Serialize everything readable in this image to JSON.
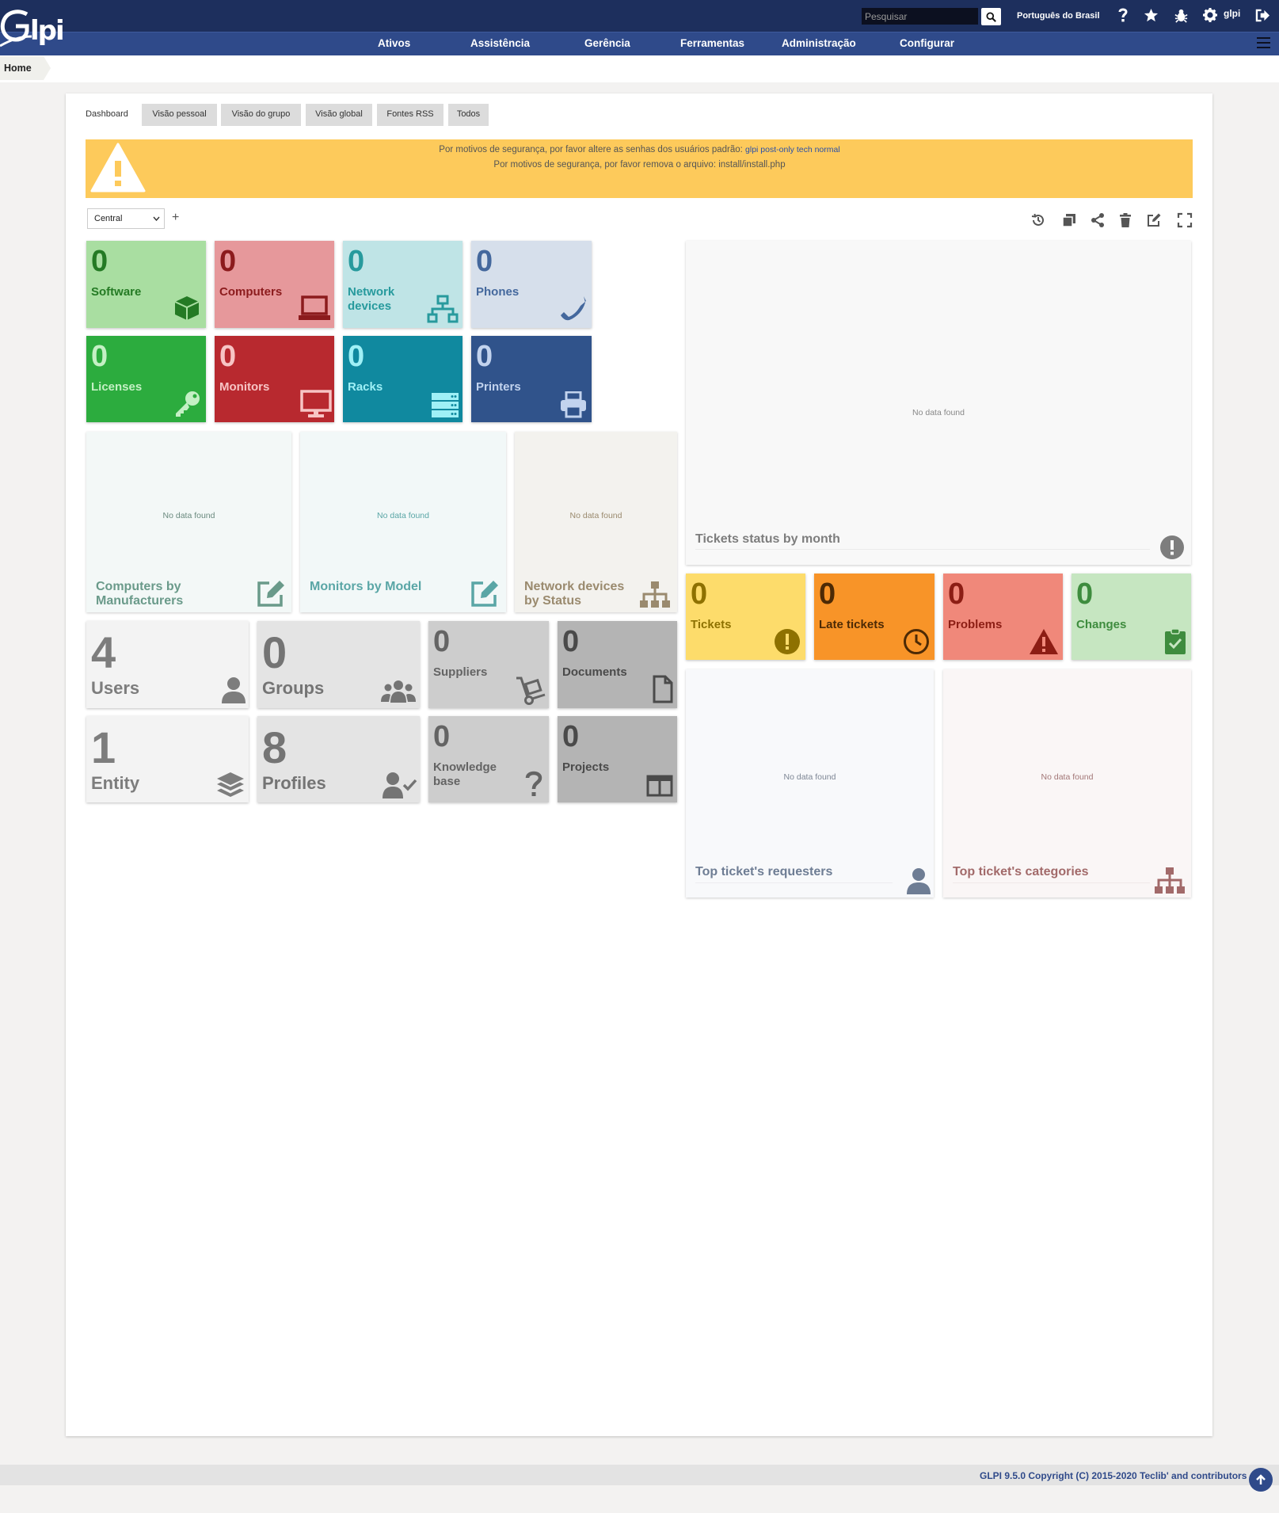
{
  "header": {
    "logo": "Glpi",
    "search_placeholder": "Pesquisar",
    "language": "Português do Brasil",
    "user": "glpi",
    "icons": [
      "help-icon",
      "star-icon",
      "bug-icon",
      "gear-icon",
      "logout-icon"
    ]
  },
  "menu": [
    "Ativos",
    "Assistência",
    "Gerência",
    "Ferramentas",
    "Administração",
    "Configurar"
  ],
  "breadcrumb": {
    "home": "Home"
  },
  "tabs": [
    "Dashboard",
    "Visão pessoal",
    "Visão do grupo",
    "Visão global",
    "Fontes RSS",
    "Todos"
  ],
  "alert": {
    "line1_prefix": "Por motivos de segurança, por favor altere as senhas dos usuários padrão:",
    "line1_links": "glpi post-only tech normal",
    "line2": "Por motivos de segurança, por favor remova o arquivo: install/install.php",
    "color": "#fdca5b"
  },
  "dashboard": {
    "selected": "Central",
    "add_label": "+",
    "tools": [
      "history-icon",
      "clone-icon",
      "share-icon",
      "delete-icon",
      "edit-icon",
      "fullscreen-icon"
    ]
  },
  "cards": {
    "software": {
      "value": "0",
      "label": "Software",
      "icon": "cube-icon",
      "bg": "#a9dea1",
      "fg": "#247a24"
    },
    "computers": {
      "value": "0",
      "label": "Computers",
      "icon": "laptop-icon",
      "bg": "#e6989b",
      "fg": "#8c1b1d"
    },
    "network_devices": {
      "value": "0",
      "label": "Network devices",
      "icon": "network-icon",
      "bg": "#bfe4e6",
      "fg": "#279a9d"
    },
    "phones": {
      "value": "0",
      "label": "Phones",
      "icon": "phone-icon",
      "bg": "#d6dfeb",
      "fg": "#44689d"
    },
    "licenses": {
      "value": "0",
      "label": "Licenses",
      "icon": "key-icon",
      "bg": "#2cac3e",
      "fg": "#c4f0c4"
    },
    "monitors": {
      "value": "0",
      "label": "Monitors",
      "icon": "monitor-icon",
      "bg": "#b8292f",
      "fg": "#f7c4c4"
    },
    "racks": {
      "value": "0",
      "label": "Racks",
      "icon": "server-icon",
      "bg": "#10899f",
      "fg": "#9ff0f6"
    },
    "printers": {
      "value": "0",
      "label": "Printers",
      "icon": "printer-icon",
      "bg": "#30538b",
      "fg": "#c2d3ee"
    },
    "users": {
      "value": "4",
      "label": "Users",
      "icon": "user-icon"
    },
    "groups": {
      "value": "0",
      "label": "Groups",
      "icon": "users-icon"
    },
    "suppliers": {
      "value": "0",
      "label": "Suppliers",
      "icon": "dolly-icon"
    },
    "documents": {
      "value": "0",
      "label": "Documents",
      "icon": "file-icon"
    },
    "entity": {
      "value": "1",
      "label": "Entity",
      "icon": "layers-icon"
    },
    "profiles": {
      "value": "8",
      "label": "Profiles",
      "icon": "user-check-icon"
    },
    "knowledge": {
      "value": "0",
      "label": "Knowledge base",
      "icon": "question-icon"
    },
    "projects": {
      "value": "0",
      "label": "Projects",
      "icon": "columns-icon"
    },
    "tickets": {
      "value": "0",
      "label": "Tickets",
      "icon": "exclamation-circle-icon",
      "bg": "#fddc6b",
      "fg": "#8e7100"
    },
    "late_tickets": {
      "value": "0",
      "label": "Late tickets",
      "icon": "clock-icon",
      "bg": "#f89428",
      "fg": "#4d2a05"
    },
    "problems": {
      "value": "0",
      "label": "Problems",
      "icon": "warning-icon",
      "bg": "#f0887a",
      "fg": "#8c1d14"
    },
    "changes": {
      "value": "0",
      "label": "Changes",
      "icon": "clipboard-check-icon",
      "bg": "#c6e6c1",
      "fg": "#3e8c3e"
    }
  },
  "panels": {
    "no_data": "No data found",
    "computers_by_manufacturers": "Computers by Manufacturers",
    "monitors_by_model": "Monitors by Model",
    "network_devices_by_status": "Network devices by Status",
    "tickets_status_by_month": "Tickets status by month",
    "top_requesters": "Top ticket's requesters",
    "top_categories": "Top ticket's categories"
  },
  "footer": {
    "copyright": "GLPI 9.5.0 Copyright (C) 2015-2020 Teclib' and contributors"
  }
}
